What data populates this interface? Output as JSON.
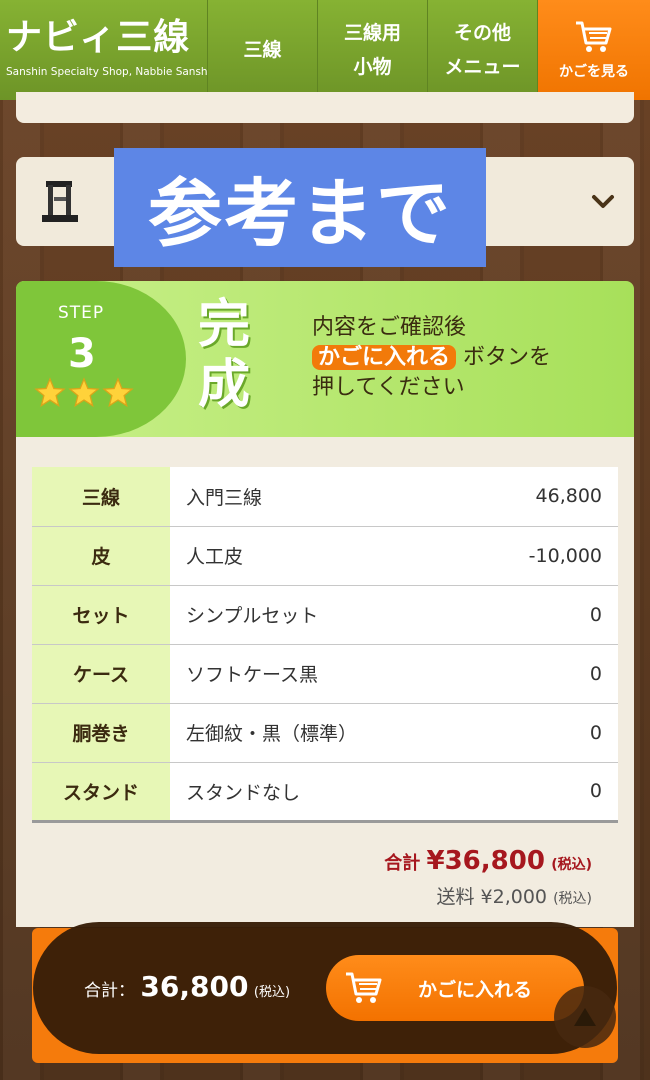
{
  "header": {
    "logo_title": "ナビィ三線",
    "logo_subtitle": "Sanshin Specialty Shop, Nabbie Sanshin",
    "nav": [
      {
        "label": "三線"
      },
      {
        "label_lines": [
          "三線用",
          "小物"
        ]
      },
      {
        "label_lines": [
          "その他",
          "メニュー"
        ]
      }
    ],
    "cart_label": "かごを見る"
  },
  "reference_banner": "参考まで",
  "step": {
    "word": "STEP",
    "number": "3",
    "stars": 3,
    "kanji": "完成",
    "text_line1": "内容をご確認後",
    "text_highlight": "かごに入れる",
    "text_line2_after": " ボタンを",
    "text_line3": "押してください"
  },
  "summary": {
    "rows": [
      {
        "key": "三線",
        "name": "入門三線",
        "value": "46,800"
      },
      {
        "key": "皮",
        "name": "人工皮",
        "value": "-10,000"
      },
      {
        "key": "セット",
        "name": "シンプルセット",
        "value": "0"
      },
      {
        "key": "ケース",
        "name": "ソフトケース黒",
        "value": "0"
      },
      {
        "key": "胴巻き",
        "name": "左御紋・黒（標準）",
        "value": "0"
      },
      {
        "key": "スタンド",
        "name": "スタンドなし",
        "value": "0"
      }
    ],
    "total_label": "合計",
    "total_value": "¥36,800",
    "total_tax": "(税込)",
    "shipping_label": "送料",
    "shipping_value": "¥2,000",
    "shipping_tax": "(税込)"
  },
  "footer_bar": {
    "total_label": "合計：",
    "total_amount": "36,800",
    "total_tax": "(税込)",
    "add_to_cart_label": "かごに入れる"
  },
  "colors": {
    "header_green": "#7aa12e",
    "accent_orange": "#f57b0c",
    "total_red": "#a6171e",
    "table_key_bg": "#e7f7b6"
  }
}
